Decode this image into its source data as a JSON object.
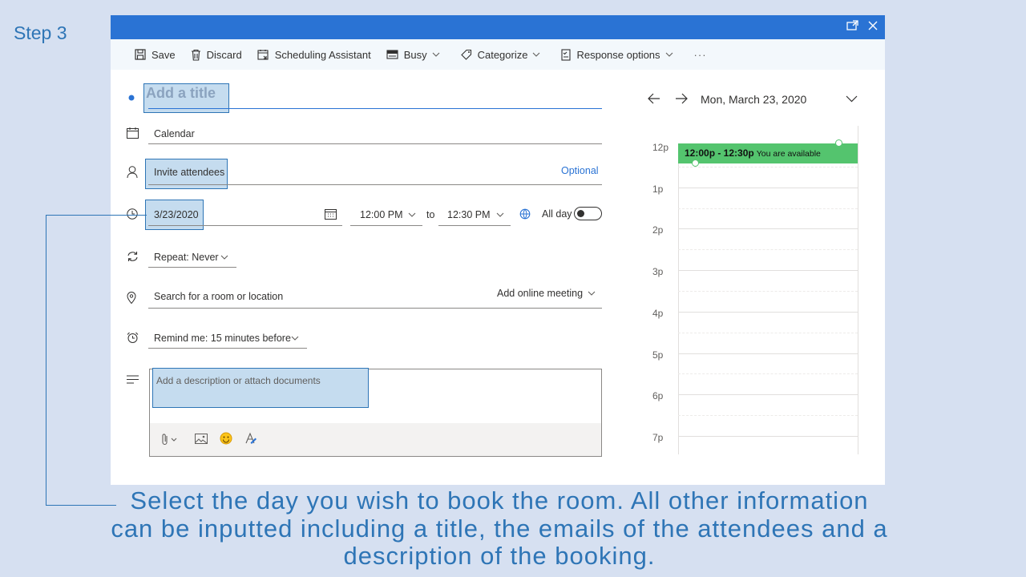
{
  "step_label": "Step 3",
  "toolbar": {
    "save": "Save",
    "discard": "Discard",
    "scheduling_assistant": "Scheduling Assistant",
    "busy": "Busy",
    "categorize": "Categorize",
    "response_options": "Response options",
    "more": "···"
  },
  "form": {
    "title_placeholder": "Add a title",
    "calendar": "Calendar",
    "invite_attendees": "Invite attendees",
    "optional": "Optional",
    "date": "3/23/2020",
    "start_time": "12:00 PM",
    "to": "to",
    "end_time": "12:30 PM",
    "all_day": "All day",
    "repeat": "Repeat:  Never",
    "location_placeholder": "Search for a room or location",
    "add_online_meeting": "Add online meeting",
    "remind": "Remind me:  15 minutes before",
    "description_placeholder": "Add a description or attach documents"
  },
  "calendar": {
    "date_label": "Mon, March 23, 2020",
    "hours": [
      "12p",
      "1p",
      "2p",
      "3p",
      "4p",
      "5p",
      "6p",
      "7p"
    ],
    "event_time": "12:00p - 12:30p",
    "event_status": "You are available"
  },
  "caption": "Select the day you wish to book the room. All other information can be inputted including a title, the emails of the attendees and a description of the booking.",
  "colors": {
    "accent": "#2a73d4",
    "highlight": "#c5dcef",
    "event": "#54c46e",
    "caption": "#2e75b6"
  }
}
